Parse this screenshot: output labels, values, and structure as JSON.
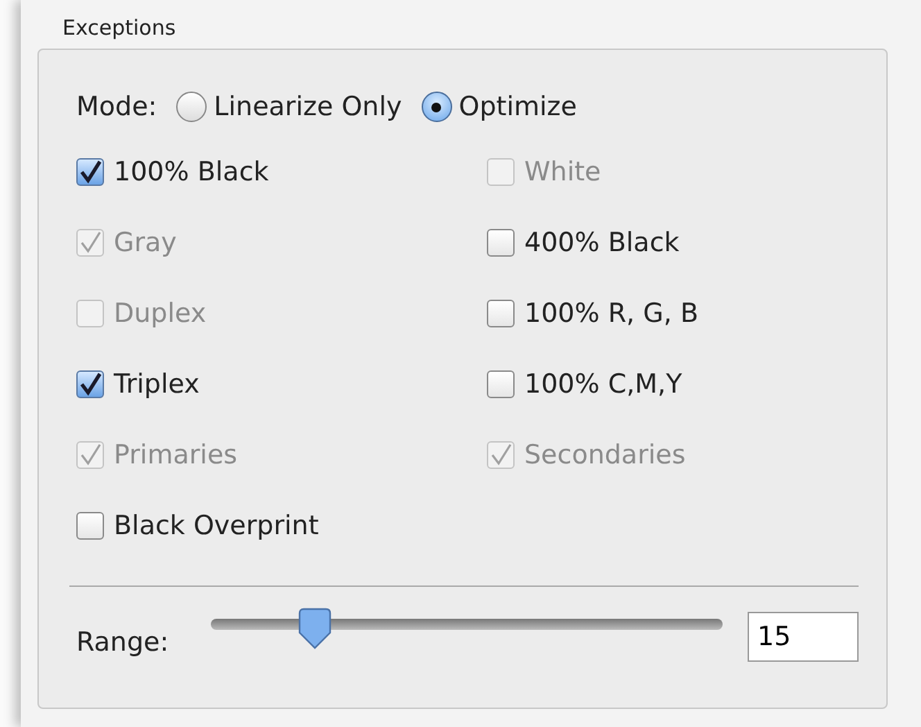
{
  "group": {
    "title": "Exceptions"
  },
  "mode": {
    "label": "Mode:",
    "options": [
      {
        "label": "Linearize Only",
        "selected": false
      },
      {
        "label": "Optimize",
        "selected": true
      }
    ]
  },
  "checkboxes": [
    {
      "label": "100% Black",
      "checked": true,
      "disabled": false
    },
    {
      "label": "White",
      "checked": false,
      "disabled": true
    },
    {
      "label": "Gray",
      "checked": true,
      "disabled": true
    },
    {
      "label": "400% Black",
      "checked": false,
      "disabled": false
    },
    {
      "label": "Duplex",
      "checked": false,
      "disabled": true
    },
    {
      "label": "100% R, G, B",
      "checked": false,
      "disabled": false
    },
    {
      "label": "Triplex",
      "checked": true,
      "disabled": false
    },
    {
      "label": "100% C,M,Y",
      "checked": false,
      "disabled": false
    },
    {
      "label": "Primaries",
      "checked": true,
      "disabled": true
    },
    {
      "label": "Secondaries",
      "checked": true,
      "disabled": true
    },
    {
      "label": "Black Overprint",
      "checked": false,
      "disabled": false
    }
  ],
  "range": {
    "label": "Range:",
    "level": 0.18,
    "value": "15"
  }
}
